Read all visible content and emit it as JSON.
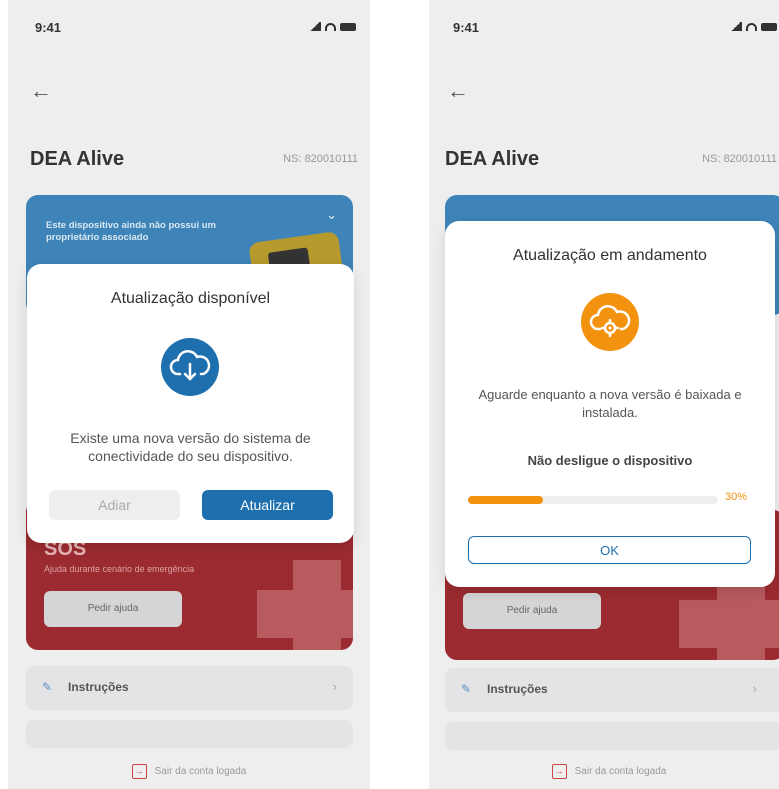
{
  "colors": {
    "primary_blue": "#1d6fae",
    "update_orange": "#f2920f",
    "card_blue": "#3e84b8",
    "sos_red": "#9b2b30"
  },
  "left_screen": {
    "status_time": "9:41",
    "device_name": "DEA Alive",
    "serial": "NS: 820010111",
    "owner_notice": "Este dispositivo ainda não possui um proprietário associado",
    "sos_title": "SOS",
    "sos_subtitle": "Ajuda durante cenário de emergência",
    "help_button": "Pedir ajuda",
    "menu_instructions": "Instruções",
    "logout": "Sair da conta logada",
    "modal": {
      "title": "Atualização disponível",
      "icon": "cloud-download-icon",
      "body": "Existe uma nova versão do sistema de conectividade do seu dispositivo.",
      "later_button": "Adiar",
      "update_button": "Atualizar"
    }
  },
  "right_screen": {
    "status_time": "9:41",
    "device_name": "DEA Alive",
    "serial": "NS: 820010111",
    "help_button": "Pedir ajuda",
    "menu_instructions": "Instruções",
    "logout": "Sair da conta logada",
    "modal": {
      "title": "Atualização em andamento",
      "icon": "cloud-gear-icon",
      "body": "Aguarde enquanto a nova versão é baixada e instalada.",
      "warning": "Não desligue o dispositivo",
      "progress_percent": 30,
      "progress_label": "30%",
      "ok_button": "OK"
    }
  }
}
